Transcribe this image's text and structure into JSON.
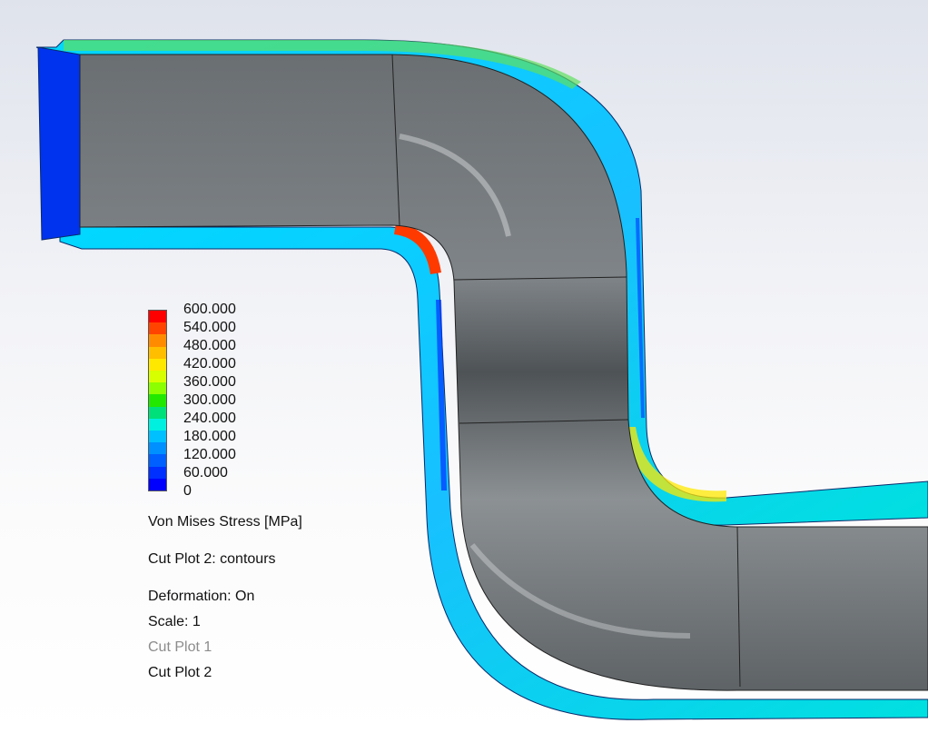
{
  "legend": {
    "ticks": [
      "600.000",
      "540.000",
      "480.000",
      "420.000",
      "360.000",
      "300.000",
      "240.000",
      "180.000",
      "120.000",
      "60.000",
      "0"
    ],
    "colors": [
      "#ff0000",
      "#ff4400",
      "#ff8c00",
      "#ffbe00",
      "#ffe800",
      "#d8ff00",
      "#8cff00",
      "#22e800",
      "#00e07a",
      "#00f0e0",
      "#00c0ff",
      "#0090ff",
      "#0060ff",
      "#0030ff",
      "#0000ff"
    ],
    "quantity": "Von Mises Stress [MPa]"
  },
  "plot_info": {
    "cut_plot": "Cut Plot 2: contours",
    "deformation": "Deformation:  On",
    "scale": "Scale:  1",
    "item1": "Cut Plot 1",
    "item2": "Cut Plot 2"
  }
}
